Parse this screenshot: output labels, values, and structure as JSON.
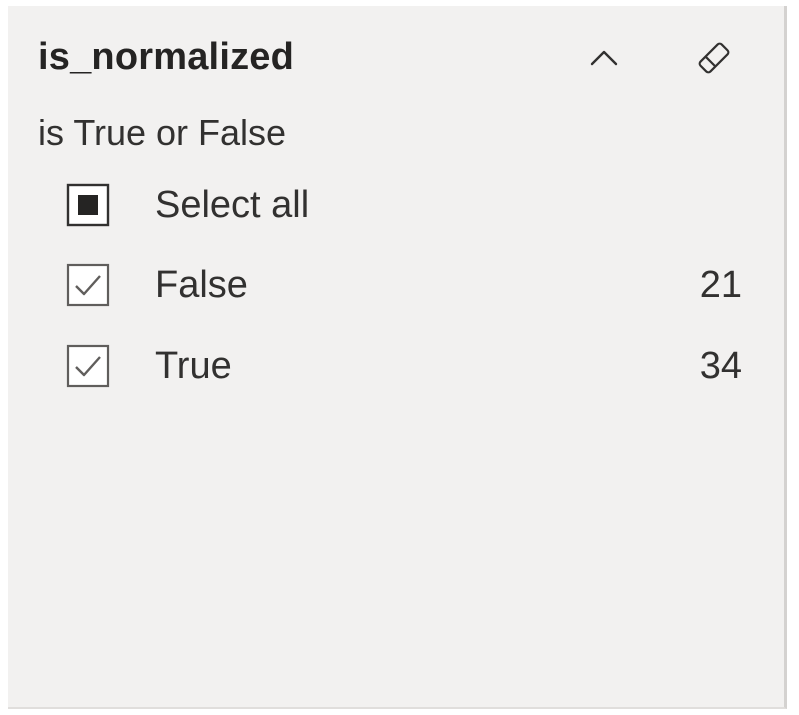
{
  "slicer": {
    "title": "is_normalized",
    "subtitle": "is True or False",
    "icons": {
      "collapse": "chevron-up-icon",
      "clear": "eraser-icon"
    },
    "items": [
      {
        "label": "Select all",
        "count": "",
        "state": "indeterminate"
      },
      {
        "label": "False",
        "count": "21",
        "state": "checked"
      },
      {
        "label": "True",
        "count": "34",
        "state": "checked"
      }
    ]
  },
  "colors": {
    "panel_background": "#f2f1f0",
    "text": "#252423",
    "checkbox_border": "#605e5c"
  }
}
